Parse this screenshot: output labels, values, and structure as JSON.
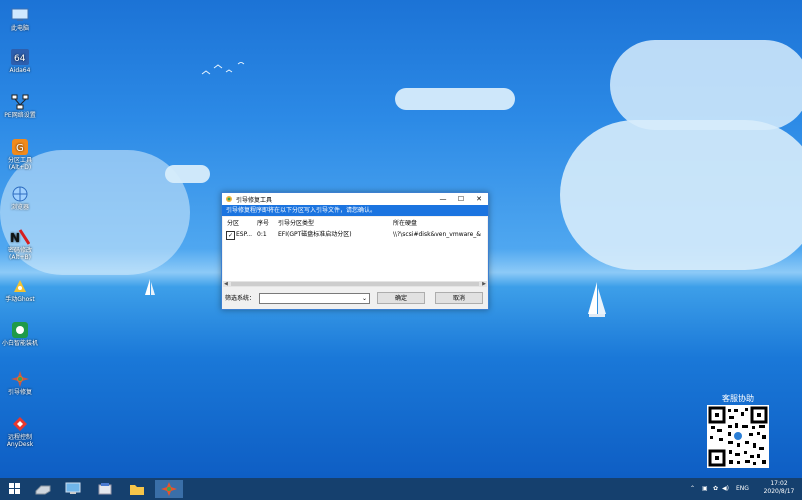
{
  "desktop_icons": [
    {
      "label": "此电脑",
      "icon": "computer-icon"
    },
    {
      "label": "Aida64",
      "icon": "aida64-icon"
    },
    {
      "label": "PE网络设置",
      "icon": "network-icon"
    },
    {
      "label": "分区工具\n(Alt+D)",
      "icon": "partition-icon"
    },
    {
      "label": "浏览器",
      "icon": "browser-icon"
    },
    {
      "label": "密码修改\n(Alt+B)",
      "icon": "password-icon"
    },
    {
      "label": "手动Ghost",
      "icon": "ghost-icon"
    },
    {
      "label": "小白智能装机",
      "icon": "installer-icon"
    },
    {
      "label": "引导修复",
      "icon": "boot-repair-icon"
    },
    {
      "label": "远程控制\nAnyDesk",
      "icon": "anydesk-icon"
    }
  ],
  "window": {
    "title": "引导修复工具",
    "info_text": "引导修复程序即将在以下分区写入引导文件，请您确认。",
    "columns": [
      "分区",
      "序号",
      "引导分区类型",
      "所在硬盘"
    ],
    "rows": [
      {
        "checked": true,
        "partition": "ESP...",
        "index": "0:1",
        "type": "EFI(GPT磁盘标准启动分区)",
        "disk": "\\\\?\\scsi#disk&ven_vmware_&"
      }
    ],
    "filter_label": "筛选系统：",
    "filter_value": "",
    "ok_label": "确定",
    "cancel_label": "取消"
  },
  "qr": {
    "title": "客服协助"
  },
  "taskbar": {
    "lang": "ENG",
    "time": "17:02",
    "date": "2020/8/17"
  },
  "colors": {
    "accent": "#1b74e0",
    "taskbar": "#15406e"
  }
}
